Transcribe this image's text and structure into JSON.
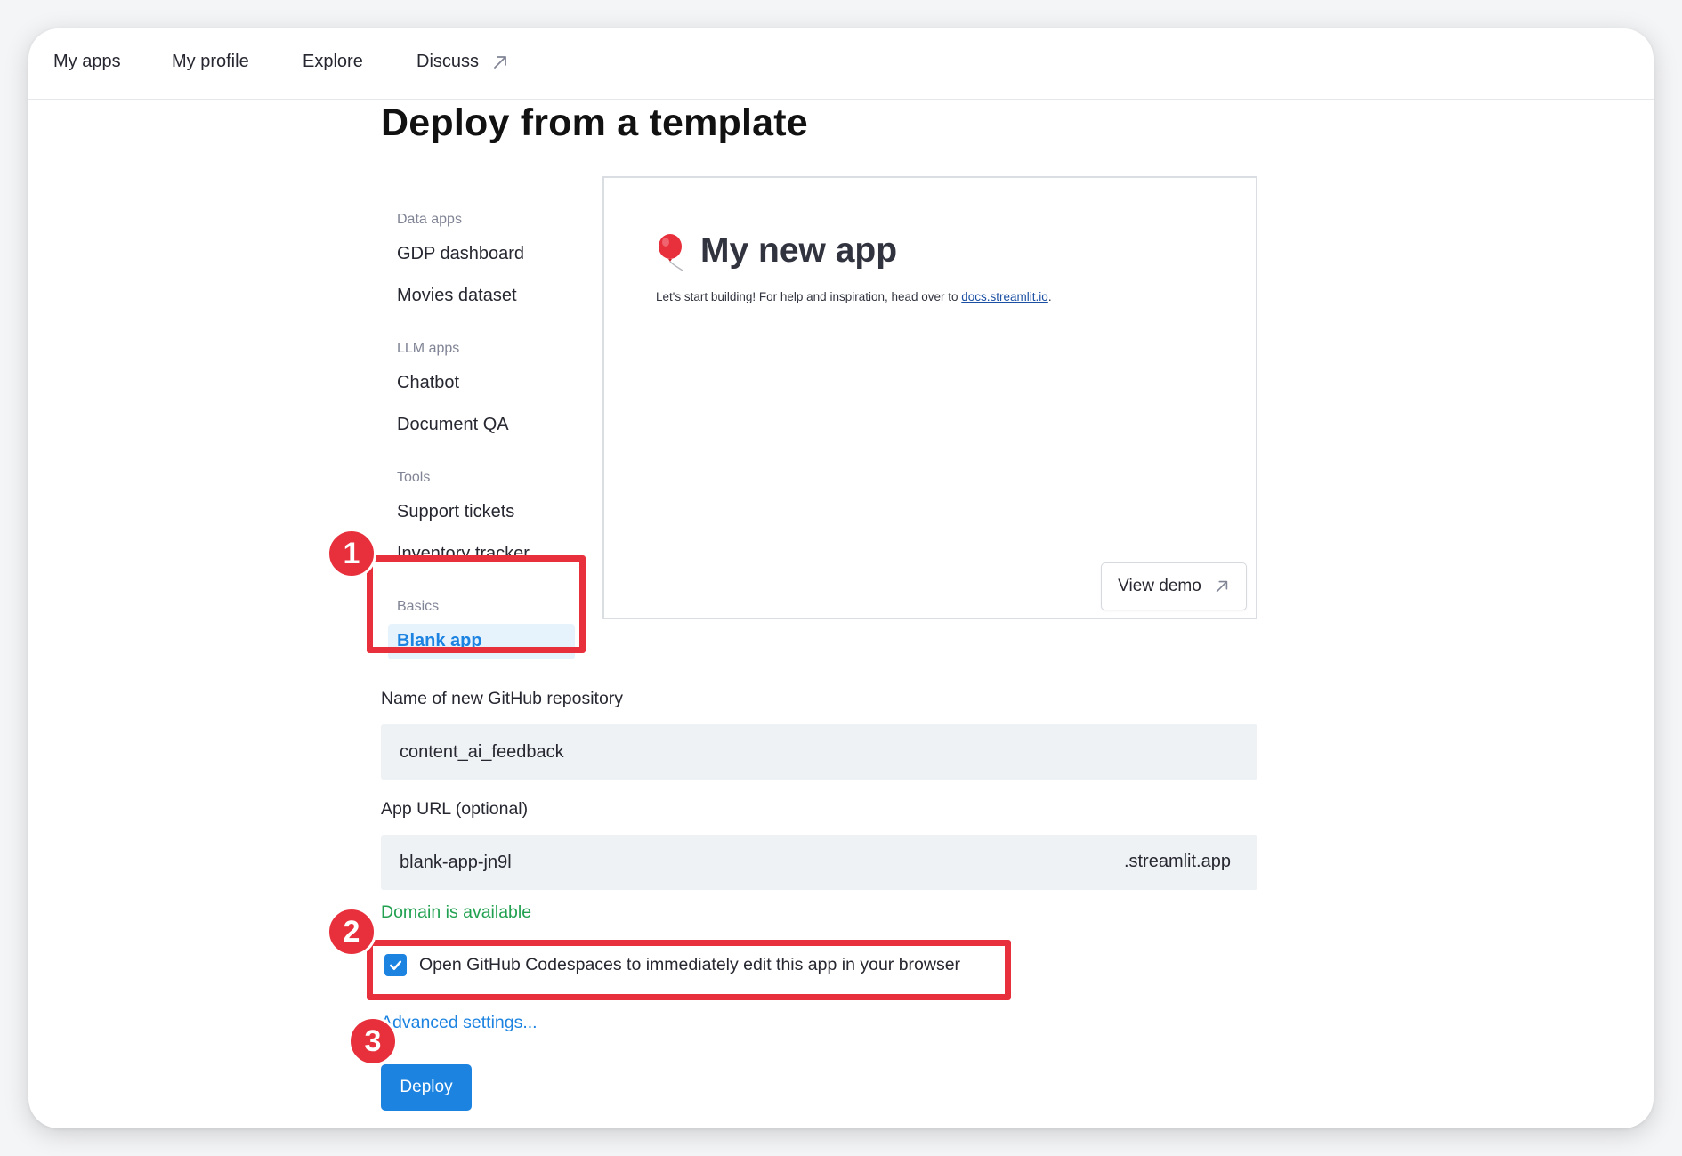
{
  "nav": {
    "items": [
      "My apps",
      "My profile",
      "Explore",
      "Discuss"
    ],
    "external_icon": "arrow-up-right-icon"
  },
  "page": {
    "title": "Deploy from a template"
  },
  "sidebar": {
    "categories": [
      {
        "label": "Data apps",
        "items": [
          "GDP dashboard",
          "Movies dataset"
        ]
      },
      {
        "label": "LLM apps",
        "items": [
          "Chatbot",
          "Document QA"
        ]
      },
      {
        "label": "Tools",
        "items": [
          "Support tickets",
          "Inventory tracker"
        ]
      },
      {
        "label": "Basics",
        "items": [
          "Blank app"
        ]
      }
    ],
    "selected": "Blank app"
  },
  "preview": {
    "icon": "balloon-icon",
    "title": "My new app",
    "subtitle_prefix": "Let's start building! For help and inspiration, head over to ",
    "subtitle_link": "docs.streamlit.io",
    "subtitle_suffix": ".",
    "view_demo_label": "View demo"
  },
  "form": {
    "repo_label": "Name of new GitHub repository",
    "repo_value": "content_ai_feedback",
    "url_label": "App URL (optional)",
    "url_value": "blank-app-jn9l",
    "url_suffix": ".streamlit.app",
    "availability": "Domain is available",
    "codespaces_label": "Open GitHub Codespaces to immediately edit this app in your browser",
    "codespaces_checked": true,
    "advanced_label": "Advanced settings...",
    "deploy_label": "Deploy"
  },
  "annotations": [
    "1",
    "2",
    "3"
  ],
  "colors": {
    "accent": "#1c83e1",
    "highlight": "#e8303c",
    "success": "#21a150",
    "selected_bg": "#e6f3fd",
    "input_bg": "#eff2f5"
  }
}
